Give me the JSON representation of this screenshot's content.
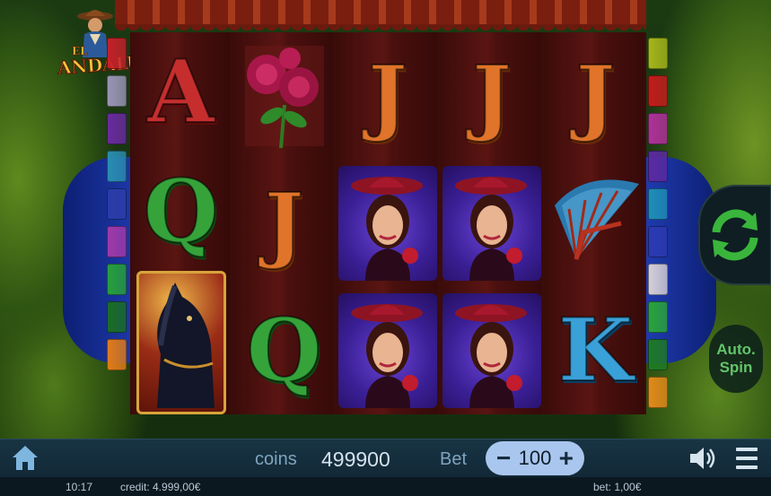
{
  "game": {
    "logo": {
      "line1": "EL",
      "line2": "ANDALUZ"
    },
    "reels": [
      [
        {
          "symbol": "A"
        },
        {
          "symbol": "Q"
        },
        {
          "symbol": "horse"
        }
      ],
      [
        {
          "symbol": "roses"
        },
        {
          "symbol": "J"
        },
        {
          "symbol": "Q"
        }
      ],
      [
        {
          "symbol": "J"
        },
        {
          "symbol": "lady"
        },
        {
          "symbol": "lady"
        }
      ],
      [
        {
          "symbol": "J"
        },
        {
          "symbol": "lady"
        },
        {
          "symbol": "lady"
        }
      ],
      [
        {
          "symbol": "J"
        },
        {
          "symbol": "fan"
        },
        {
          "symbol": "K"
        }
      ]
    ],
    "letters": {
      "r1c1": "A",
      "r1c2": "Q",
      "r2c2": "J",
      "r2c3": "Q",
      "r3c1": "J",
      "r4c1": "J",
      "r5c1": "J",
      "r5c3": "K"
    },
    "line_tabs_left": [
      "#c4202a",
      "#9a95b6",
      "#6a2aa0",
      "#2a8db0",
      "#2b3da8",
      "#a03aa8",
      "#28a03a",
      "#1b6e24",
      "#e07b1a"
    ],
    "line_tabs_right": [
      "#a6b61c",
      "#c41c1c",
      "#b0309a",
      "#5b2aa0",
      "#1e8fb5",
      "#2b3ab0",
      "#d6cfd6",
      "#2aa43a",
      "#1e7a26",
      "#e28a1a"
    ],
    "auto_spin": {
      "line1": "Auto.",
      "line2": "Spin"
    },
    "spin_icon": "refresh-arrows-icon"
  },
  "controls": {
    "coins_label": "coins",
    "coins_value": "499900",
    "bet_label": "Bet",
    "bet_value": "100",
    "minus": "−",
    "plus": "+"
  },
  "status": {
    "time": "10:17",
    "credit": "credit: 4.999,00€",
    "bet": "bet: 1,00€"
  },
  "colors": {
    "spin_green": "#39b53c",
    "bar_bg": "#152e3d",
    "bet_pill": "#a9c6ee"
  }
}
